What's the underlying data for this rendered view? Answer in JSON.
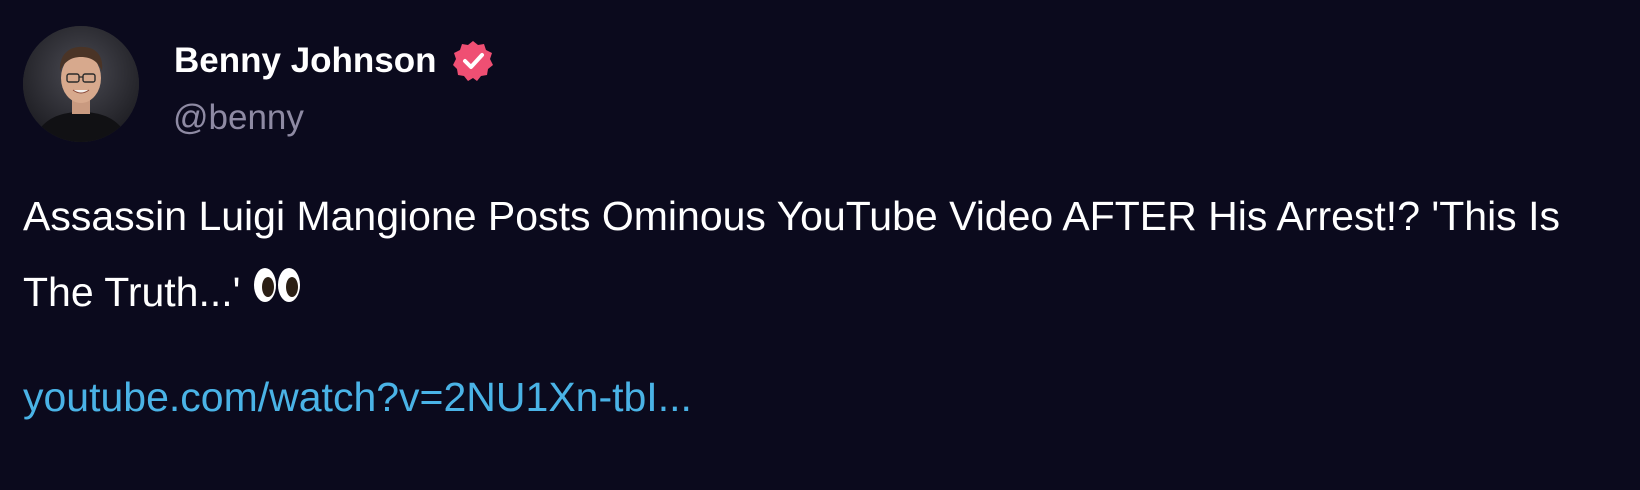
{
  "post": {
    "author": {
      "display_name": "Benny Johnson",
      "handle": "@benny",
      "verified_icon": "verified-badge-icon",
      "avatar_icon": "avatar-photo"
    },
    "text": "Assassin Luigi Mangione Posts Ominous YouTube Video AFTER His Arrest!? 'This Is The Truth...'",
    "emoji": "eyes-emoji",
    "link": "youtube.com/watch?v=2NU1Xn-tbI..."
  },
  "colors": {
    "background": "#0b0a1d",
    "text": "#ffffff",
    "handle": "#8e8aa3",
    "link": "#4ab3e6",
    "verified_badge": "#ef4f73"
  }
}
